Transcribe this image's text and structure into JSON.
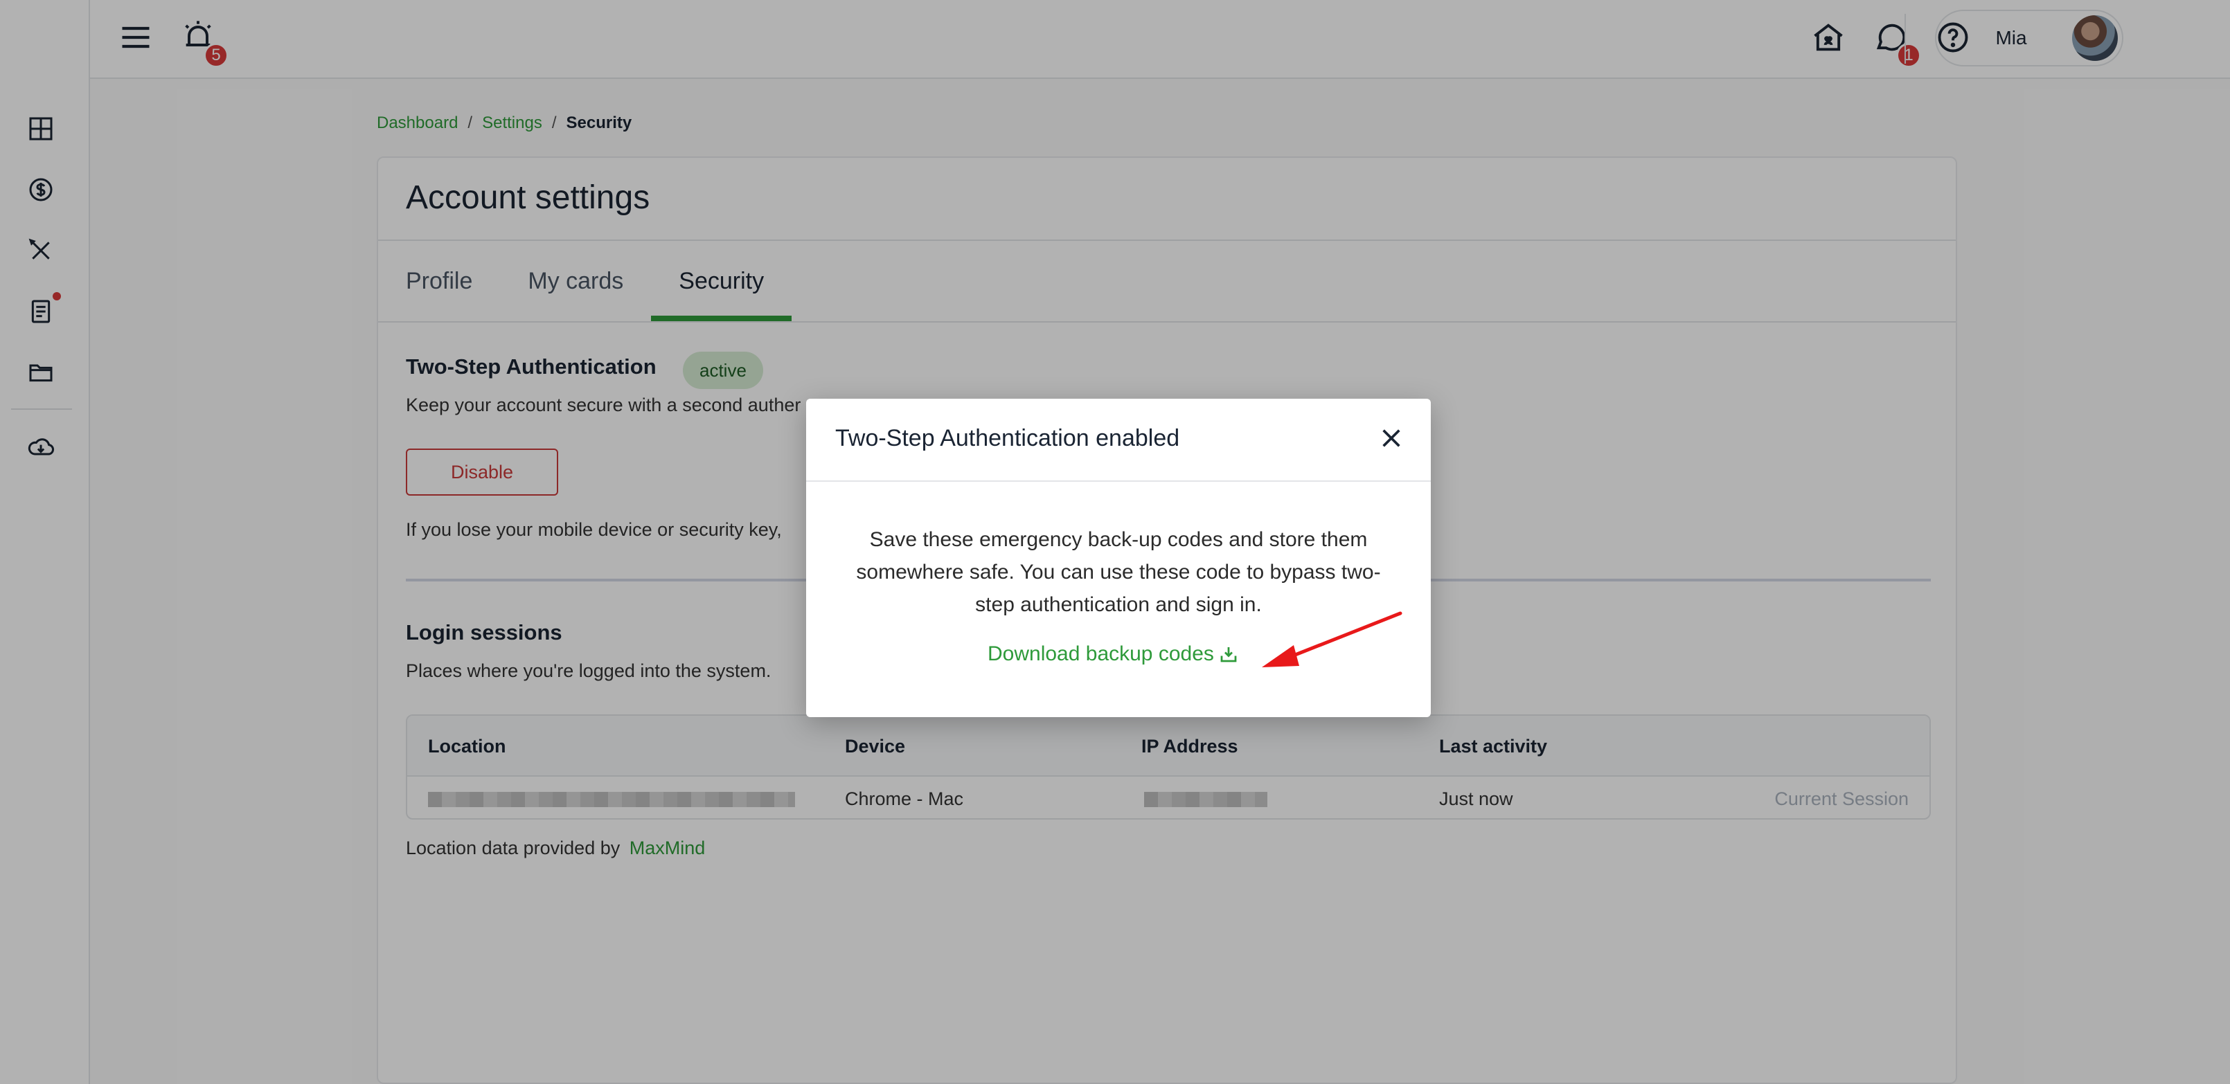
{
  "topbar": {
    "alarm_badge": "5",
    "chat_badge": "1",
    "user_name": "Mia"
  },
  "breadcrumb": {
    "items": [
      "Dashboard",
      "Settings"
    ],
    "separator": "/",
    "current": "Security"
  },
  "card": {
    "title": "Account settings",
    "tabs": [
      {
        "label": "Profile",
        "active": false
      },
      {
        "label": "My cards",
        "active": false
      },
      {
        "label": "Security",
        "active": true
      }
    ]
  },
  "two_step": {
    "title": "Two-Step Authentication",
    "status": "active",
    "description": "Keep your account secure with a second auther",
    "disable_label": "Disable",
    "lose_text": "If you lose your mobile device or security key,"
  },
  "login_sessions": {
    "title": "Login sessions",
    "description": "Places where you're logged into the system.",
    "columns": [
      "Location",
      "Device",
      "IP Address",
      "Last activity"
    ],
    "rows": [
      {
        "device": "Chrome - Mac",
        "last_activity": "Just now",
        "current": "Current Session"
      }
    ],
    "provider_text": "Location data provided by",
    "provider_link": "MaxMind"
  },
  "modal": {
    "title": "Two-Step Authentication enabled",
    "body": "Save these emergency back-up codes and store them somewhere safe. You can use these code to bypass two-step authentication and sign in.",
    "download_label": "Download backup codes"
  },
  "colors": {
    "accent_green": "#2e9a3a",
    "danger_red": "#c93a3a",
    "annotation_red": "#e8191a"
  }
}
